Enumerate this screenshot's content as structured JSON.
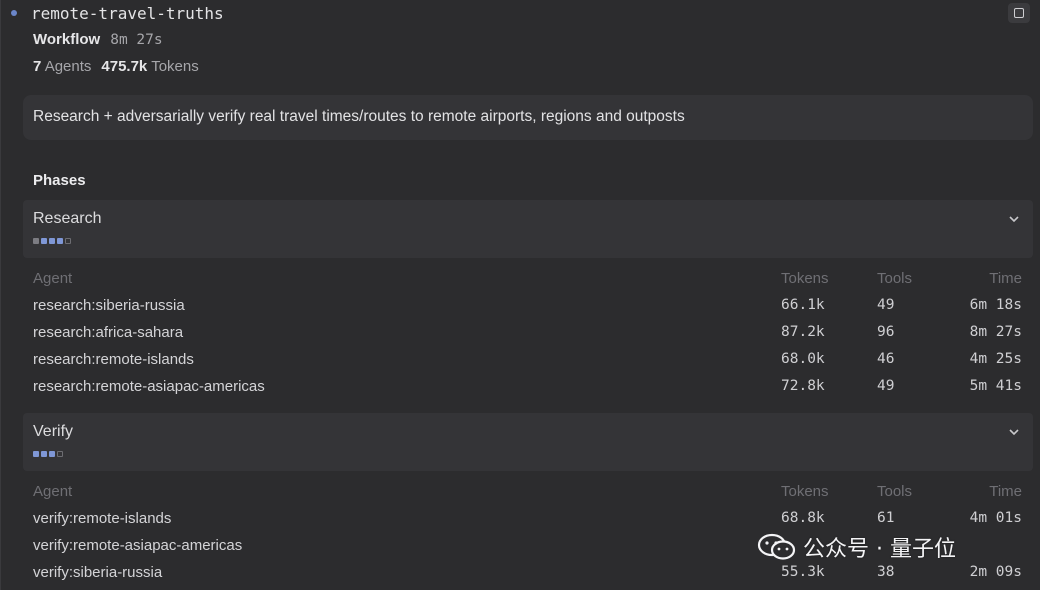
{
  "header": {
    "title": "remote-travel-truths",
    "workflow_label": "Workflow",
    "workflow_time": "8m 27s",
    "agents_count": "7",
    "agents_label": "Agents",
    "tokens_count": "475.7k",
    "tokens_label": "Tokens"
  },
  "description": "Research + adversarially verify real travel times/routes to remote airports, regions and outposts",
  "phases_label": "Phases",
  "columns": {
    "agent": "Agent",
    "tokens": "Tokens",
    "tools": "Tools",
    "time": "Time"
  },
  "phases": [
    {
      "name": "Research",
      "progress": {
        "completed": 1,
        "active": 3,
        "pending": 1
      },
      "rows": [
        {
          "agent": "research:siberia-russia",
          "tokens": "66.1k",
          "tools": "49",
          "time": "6m 18s"
        },
        {
          "agent": "research:africa-sahara",
          "tokens": "87.2k",
          "tools": "96",
          "time": "8m 27s"
        },
        {
          "agent": "research:remote-islands",
          "tokens": "68.0k",
          "tools": "46",
          "time": "4m 25s"
        },
        {
          "agent": "research:remote-asiapac-americas",
          "tokens": "72.8k",
          "tools": "49",
          "time": "5m 41s"
        }
      ]
    },
    {
      "name": "Verify",
      "progress": {
        "completed": 0,
        "active": 3,
        "pending": 1
      },
      "rows": [
        {
          "agent": "verify:remote-islands",
          "tokens": "68.8k",
          "tools": "61",
          "time": "4m 01s"
        },
        {
          "agent": "verify:remote-asiapac-americas",
          "tokens": "",
          "tools": "",
          "time": ""
        },
        {
          "agent": "verify:siberia-russia",
          "tokens": "55.3k",
          "tools": "38",
          "time": "2m 09s"
        }
      ]
    }
  ],
  "watermark": {
    "text": "公众号 · 量子位"
  },
  "colors": {
    "background": "#2c2c2e",
    "panel": "#343437",
    "accent": "#7f97d6"
  },
  "icons": {
    "status": "status-dot-icon",
    "window": "square-icon",
    "expand": "chevron-down-icon"
  }
}
